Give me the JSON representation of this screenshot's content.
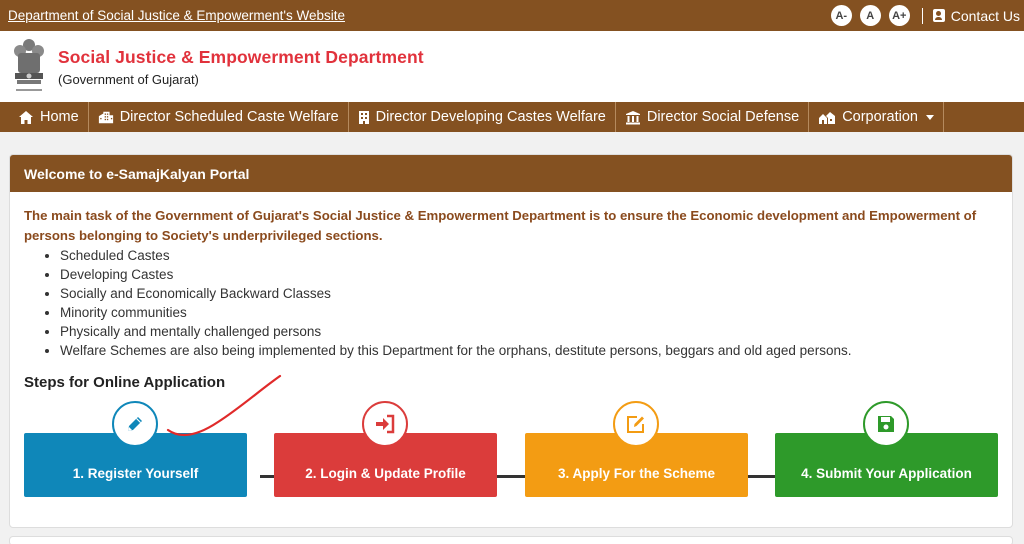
{
  "topbar": {
    "site_link": "Department of Social Justice & Empowerment's Website",
    "font_decrease": "A-",
    "font_normal": "A",
    "font_increase": "A+",
    "contact": "Contact Us"
  },
  "header": {
    "title": "Social Justice & Empowerment Department",
    "subtitle": "(Government of Gujarat)"
  },
  "nav": {
    "items": [
      {
        "label": "Home",
        "icon": "home-icon"
      },
      {
        "label": "Director Scheduled Caste Welfare",
        "icon": "building-icon"
      },
      {
        "label": "Director Developing Castes Welfare",
        "icon": "building-icon"
      },
      {
        "label": "Director Social Defense",
        "icon": "institution-icon"
      },
      {
        "label": "Corporation",
        "icon": "houses-icon"
      }
    ]
  },
  "welcome": {
    "heading": "Welcome to e-SamajKalyan Portal",
    "intro": "The main task of the Government of Gujarat's Social Justice & Empowerment Department is to ensure the Economic development and Empowerment of persons belonging to Society's underprivileged sections.",
    "bullets": [
      "Scheduled Castes",
      "Developing Castes",
      "Socially and Economically Backward Classes",
      "Minority communities",
      "Physically and mentally challenged persons",
      "Welfare Schemes are also being implemented by this Department for the orphans, destitute persons, beggars and old aged persons."
    ],
    "steps_title": "Steps for Online Application"
  },
  "steps": [
    {
      "label": "1. Register Yourself",
      "icon": "pencil-icon",
      "color": "#0f87b9"
    },
    {
      "label": "2. Login & Update Profile",
      "icon": "sign-in-icon",
      "color": "#db3c3b"
    },
    {
      "label": "3. Apply For the Scheme",
      "icon": "edit-icon",
      "color": "#f39c13"
    },
    {
      "label": "4. Submit Your Application",
      "icon": "save-icon",
      "color": "#2e9a2a"
    }
  ],
  "colors": {
    "brand_brown": "#845121",
    "title_red": "#e1323c",
    "intro_brown": "#8a4a1d"
  }
}
